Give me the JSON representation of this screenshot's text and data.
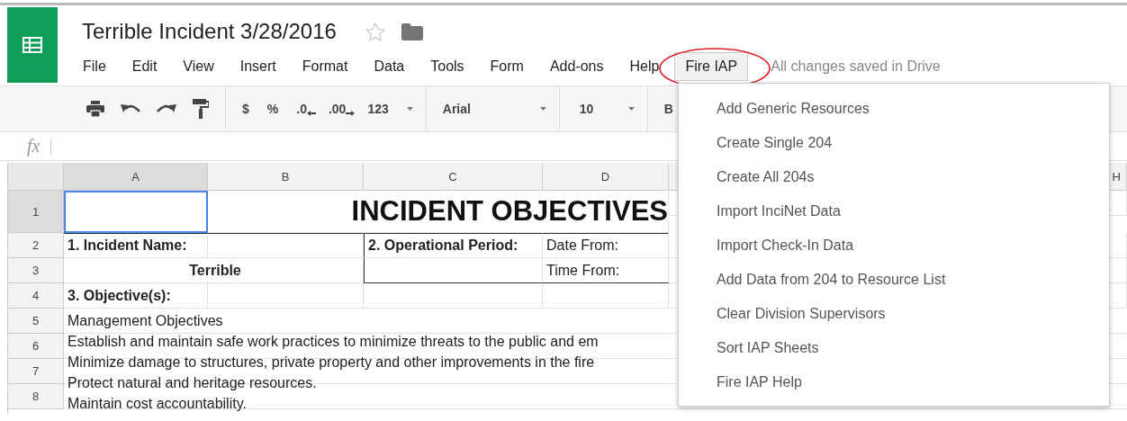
{
  "title": "Terrible Incident 3/28/2016",
  "starred": false,
  "menus": [
    {
      "label": "File",
      "selected": false
    },
    {
      "label": "Edit",
      "selected": false
    },
    {
      "label": "View",
      "selected": false
    },
    {
      "label": "Insert",
      "selected": false
    },
    {
      "label": "Format",
      "selected": false
    },
    {
      "label": "Data",
      "selected": false
    },
    {
      "label": "Tools",
      "selected": false
    },
    {
      "label": "Form",
      "selected": false
    },
    {
      "label": "Add-ons",
      "selected": false
    },
    {
      "label": "Help",
      "selected": false
    },
    {
      "label": "Fire IAP",
      "selected": true
    }
  ],
  "save_status": "All changes saved in Drive",
  "toolbar": {
    "currency": "$",
    "percent": "%",
    "decrease_decimals": ".0",
    "increase_decimals": ".00",
    "number_format": "123",
    "font": "Arial",
    "font_size": "10",
    "bold": "B"
  },
  "formula_bar": {
    "label": "fx"
  },
  "columns": [
    "A",
    "B",
    "C",
    "D"
  ],
  "column_right": "H",
  "rows": [
    {
      "number": "1",
      "kind": "title",
      "cell_a_selected": true,
      "text": "INCIDENT OBJECTIVES"
    },
    {
      "number": "2",
      "kind": "cells",
      "a": "1. Incident Name:",
      "c": "2. Operational Period:",
      "d": "Date From:"
    },
    {
      "number": "3",
      "kind": "merged",
      "text": "Terrible",
      "d": "Time From:"
    },
    {
      "number": "4",
      "kind": "cells",
      "a": "3. Objective(s):"
    }
  ],
  "objective_rows": [
    "5",
    "6",
    "7",
    "8"
  ],
  "objectives": [
    "Management Objectives",
    "Establish and maintain safe work practices to minimize threats to the public and em",
    "Minimize damage to structures, private property and other improvements in the fire",
    "Protect natural and heritage resources.",
    "Maintain cost accountability."
  ],
  "dropdown": [
    "Add Generic Resources",
    "Create Single 204",
    "Create All 204s",
    "Import InciNet Data",
    "Import Check-In Data",
    "Add Data from 204 to Resource List",
    "Clear Division Supervisors",
    "Sort IAP Sheets",
    "Fire IAP Help"
  ]
}
